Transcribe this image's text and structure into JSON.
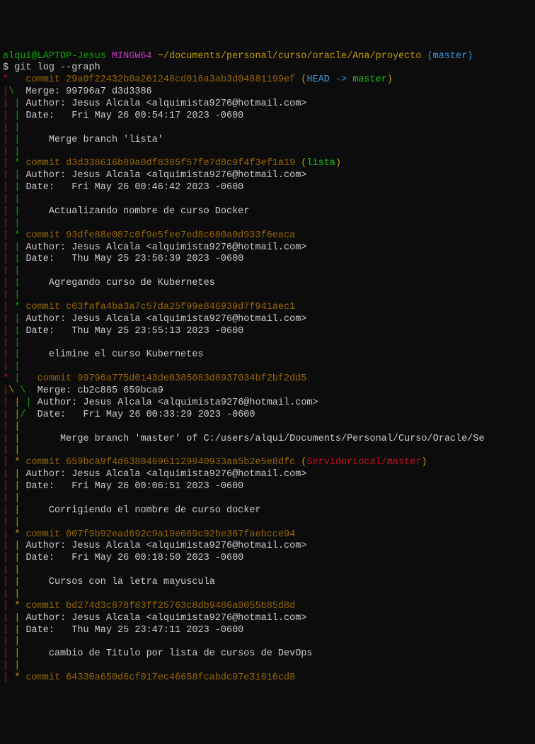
{
  "prompt": {
    "user": "alqui@LAPTOP-Jesus",
    "shell": "MINGW64",
    "path": "~/documents/personal/curso/oracle/Ana/proyecto",
    "branch": "(master)"
  },
  "command": "$ git log --graph",
  "commits": [
    {
      "graph_prefix": "*   ",
      "hash": "commit 29a0f22432b0a261248cd016a3ab3d04881199ef",
      "refs_open": " (",
      "refs_head": "HEAD -> ",
      "refs_branch": "master",
      "refs_close": ")",
      "meta_prefix_1": "|\\  ",
      "merge": "Merge: 99796a7 d3d3386",
      "meta_prefix_2": "| | ",
      "author": "Author: Jesus Alcala <alquimista9276@hotmail.com>",
      "date": "Date:   Fri May 26 00:54:17 2023 -0600",
      "blank_prefix": "| |",
      "msg_prefix": "| |     ",
      "message": "Merge branch 'lista'"
    },
    {
      "graph_prefix": "| * ",
      "hash": "commit d3d338616b89a0df8385f57fe7d8c9f4f3ef1a19",
      "refs_open": " (",
      "refs_branch": "lista",
      "refs_close": ")",
      "meta_prefix": "| | ",
      "author": "Author: Jesus Alcala <alquimista9276@hotmail.com>",
      "date": "Date:   Fri May 26 00:46:42 2023 -0600",
      "blank_prefix": "| |",
      "msg_prefix": "| |     ",
      "message": "Actualizando nombre de curso Docker"
    },
    {
      "graph_prefix": "| * ",
      "hash": "commit 93dfe88e087c0f9e5fee7ed8c680a0d933f6eaca",
      "meta_prefix": "| | ",
      "author": "Author: Jesus Alcala <alquimista9276@hotmail.com>",
      "date": "Date:   Thu May 25 23:56:39 2023 -0600",
      "blank_prefix": "| |",
      "msg_prefix": "| |     ",
      "message": "Agregando curso de Kubernetes"
    },
    {
      "graph_prefix": "| * ",
      "hash": "commit c03fafa4ba3a7c57da25f99e846939d7f941aec1",
      "meta_prefix": "| | ",
      "author": "Author: Jesus Alcala <alquimista9276@hotmail.com>",
      "date": "Date:   Thu May 25 23:55:13 2023 -0600",
      "blank_prefix": "| |",
      "msg_prefix": "| |     ",
      "message": "elimine el curso Kubernetes"
    },
    {
      "graph_prefix": "* |   ",
      "hash": "commit 99796a775d0143de0385083d8937034bf2bf2dd5",
      "meta_prefix_1": "|\\ \\  ",
      "merge": "Merge: cb2c885 659bca9",
      "meta_prefix_2": "| | | ",
      "meta_prefix_3": "| |/  ",
      "author": "Author: Jesus Alcala <alquimista9276@hotmail.com>",
      "date": "Date:   Fri May 26 00:33:29 2023 -0600",
      "blank_prefix": "| |",
      "msg_prefix": "| |       ",
      "message": "Merge branch 'master' of C:/users/alqui/Documents/Personal/Curso/Oracle/Se"
    },
    {
      "graph_prefix": "| * ",
      "hash": "commit 659bca9f4d638046961129940933aa5b2e5e8dfc",
      "refs_open": " (",
      "refs_remote": "ServidorLocal/master",
      "refs_close": ")",
      "meta_prefix": "| | ",
      "author": "Author: Jesus Alcala <alquimista9276@hotmail.com>",
      "date": "Date:   Fri May 26 00:06:51 2023 -0600",
      "blank_prefix": "| |",
      "msg_prefix": "| |     ",
      "message": "Corrigiendo el nombre de curso docker"
    },
    {
      "graph_prefix": "| * ",
      "hash": "commit 007f9b92ead692c9a19e069c92be387faebcce94",
      "meta_prefix": "| | ",
      "author": "Author: Jesus Alcala <alquimista9276@hotmail.com>",
      "date": "Date:   Fri May 26 00:18:50 2023 -0600",
      "blank_prefix": "| |",
      "msg_prefix": "| |     ",
      "message": "Cursos con la letra mayuscula"
    },
    {
      "graph_prefix": "| * ",
      "hash": "commit bd274d3c878f83ff25763c8db9486a0055b85d8d",
      "meta_prefix": "| | ",
      "author": "Author: Jesus Alcala <alquimista9276@hotmail.com>",
      "date": "Date:   Thu May 25 23:47:11 2023 -0600",
      "blank_prefix": "| |",
      "msg_prefix": "| |     ",
      "message": "cambio de Titulo por lista de cursos de DevOps"
    },
    {
      "graph_prefix": "| * ",
      "hash": "commit 64330a650d6cf017ec46658fcabdc97e31016cd8"
    }
  ]
}
